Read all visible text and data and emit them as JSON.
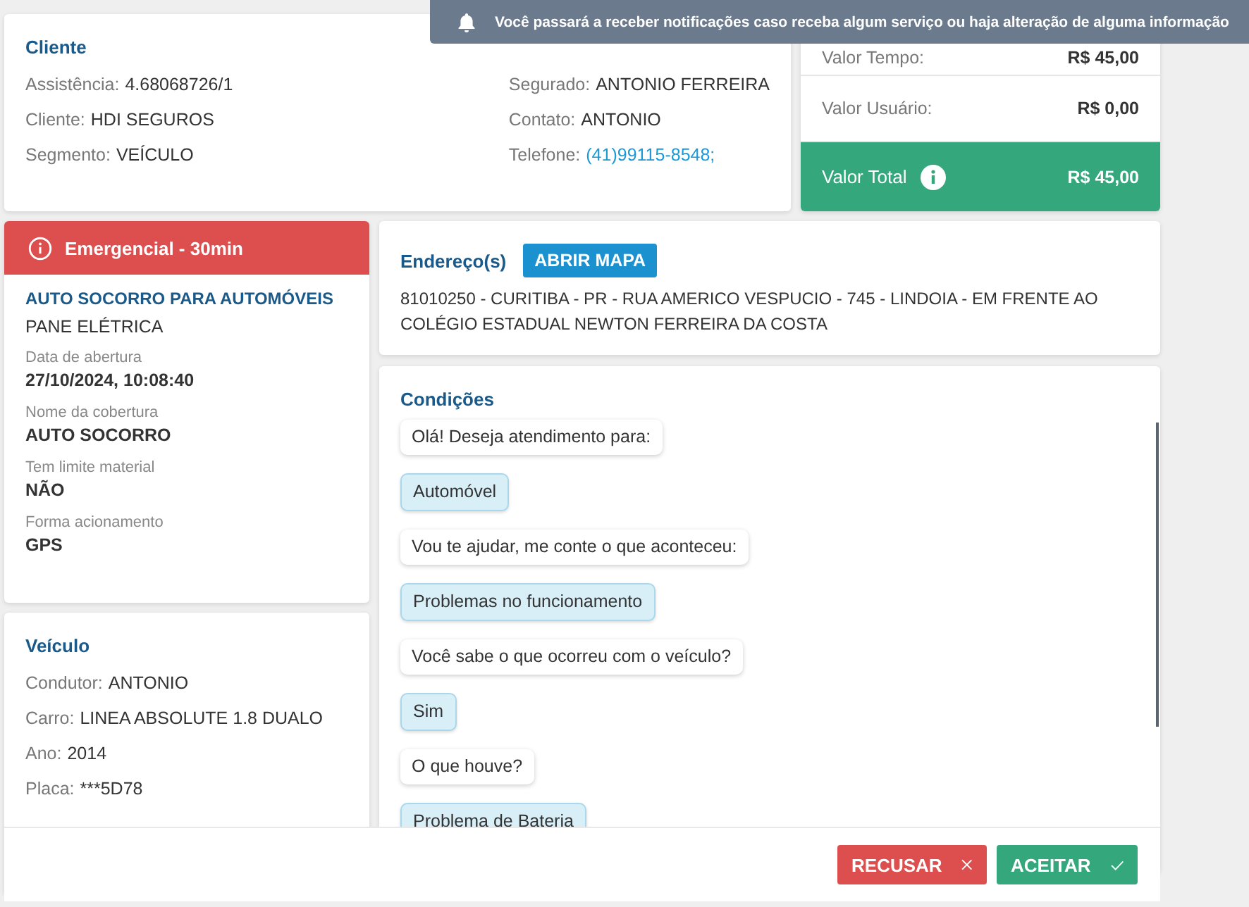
{
  "toast": {
    "text": "Você passará a receber notificações caso receba algum serviço ou haja alteração de alguma informação"
  },
  "client": {
    "title": "Cliente",
    "left": [
      {
        "label": "Assistência:",
        "value": "4.68068726/1",
        "kind": "text"
      },
      {
        "label": "Cliente:",
        "value": "HDI SEGUROS",
        "kind": "text"
      },
      {
        "label": "Segmento:",
        "value": "VEÍCULO",
        "kind": "text"
      }
    ],
    "right": [
      {
        "label": "Segurado:",
        "value": "ANTONIO FERREIRA",
        "kind": "text"
      },
      {
        "label": "Contato:",
        "value": "ANTONIO",
        "kind": "text"
      },
      {
        "label": "Telefone:",
        "value": "(41)99115-8548;",
        "kind": "link"
      }
    ]
  },
  "values": {
    "rows": [
      {
        "label": "Valor Tempo:",
        "value": "R$ 45,00"
      },
      {
        "label": "Valor Usuário:",
        "value": "R$ 0,00"
      }
    ],
    "total": {
      "label": "Valor Total",
      "value": "R$ 45,00"
    }
  },
  "service": {
    "badge": "Emergencial - 30min",
    "title": "AUTO SOCORRO PARA AUTOMÓVEIS",
    "subtitle": "PANE ELÉTRICA",
    "fields": [
      {
        "label": "Data de abertura",
        "value": "27/10/2024, 10:08:40"
      },
      {
        "label": "Nome da cobertura",
        "value": "AUTO SOCORRO"
      },
      {
        "label": "Tem limite material",
        "value": "NÃO"
      },
      {
        "label": "Forma acionamento",
        "value": "GPS"
      }
    ]
  },
  "vehicle": {
    "title": "Veículo",
    "fields": [
      {
        "label": "Condutor:",
        "value": "ANTONIO"
      },
      {
        "label": "Carro:",
        "value": "LINEA ABSOLUTE 1.8 DUALO"
      },
      {
        "label": "Ano:",
        "value": "2014"
      },
      {
        "label": "Placa:",
        "value": "***5D78"
      }
    ]
  },
  "address": {
    "title": "Endereço(s)",
    "button": "ABRIR MAPA",
    "text": "81010250 - CURITIBA - PR - RUA AMERICO VESPUCIO - 745 - LINDOIA - EM FRENTE AO COLÉGIO ESTADUAL NEWTON FERREIRA DA COSTA"
  },
  "conditions": {
    "title": "Condições",
    "messages": [
      {
        "kind": "bot",
        "text": "Olá! Deseja atendimento para:"
      },
      {
        "kind": "user",
        "text": "Automóvel"
      },
      {
        "kind": "bot",
        "text": "Vou te ajudar, me conte o que aconteceu:"
      },
      {
        "kind": "user",
        "text": "Problemas no funcionamento"
      },
      {
        "kind": "bot",
        "text": "Você sabe o que ocorreu com o veículo?"
      },
      {
        "kind": "user",
        "text": "Sim"
      },
      {
        "kind": "bot",
        "text": "O que houve?"
      },
      {
        "kind": "user",
        "text": "Problema de Bateria"
      }
    ]
  },
  "actions": [
    {
      "kind": "reject",
      "label": "RECUSAR"
    },
    {
      "kind": "accept",
      "label": "ACEITAR"
    }
  ]
}
